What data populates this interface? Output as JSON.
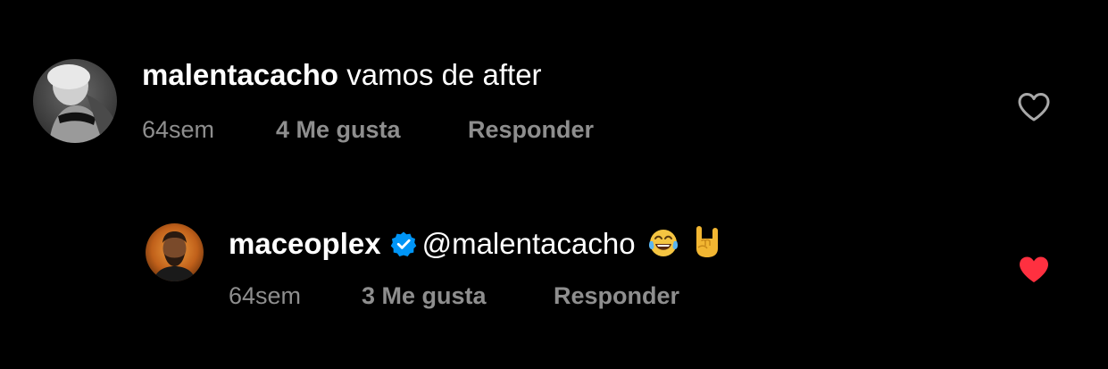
{
  "comments": [
    {
      "username": "malentacacho",
      "text": "vamos de after",
      "time": "64sem",
      "likes": "4 Me gusta",
      "reply_label": "Responder",
      "liked": false,
      "verified": false
    },
    {
      "username": "maceoplex",
      "text": "@malentacacho",
      "emojis": [
        "face-with-tears-of-joy-emoji",
        "sign-of-the-horns-emoji"
      ],
      "time": "64sem",
      "likes": "3 Me gusta",
      "reply_label": "Responder",
      "liked": true,
      "verified": true
    }
  ],
  "colors": {
    "background": "#000000",
    "text": "#ffffff",
    "meta": "#8e8e8e",
    "heart_liked": "#ff3040",
    "heart_outline": "#a8a8a8",
    "verified": "#0095f6"
  },
  "icons": {
    "heart_outline": "heart-outline-icon",
    "heart_filled": "heart-filled-icon",
    "verified": "verified-badge-icon"
  }
}
